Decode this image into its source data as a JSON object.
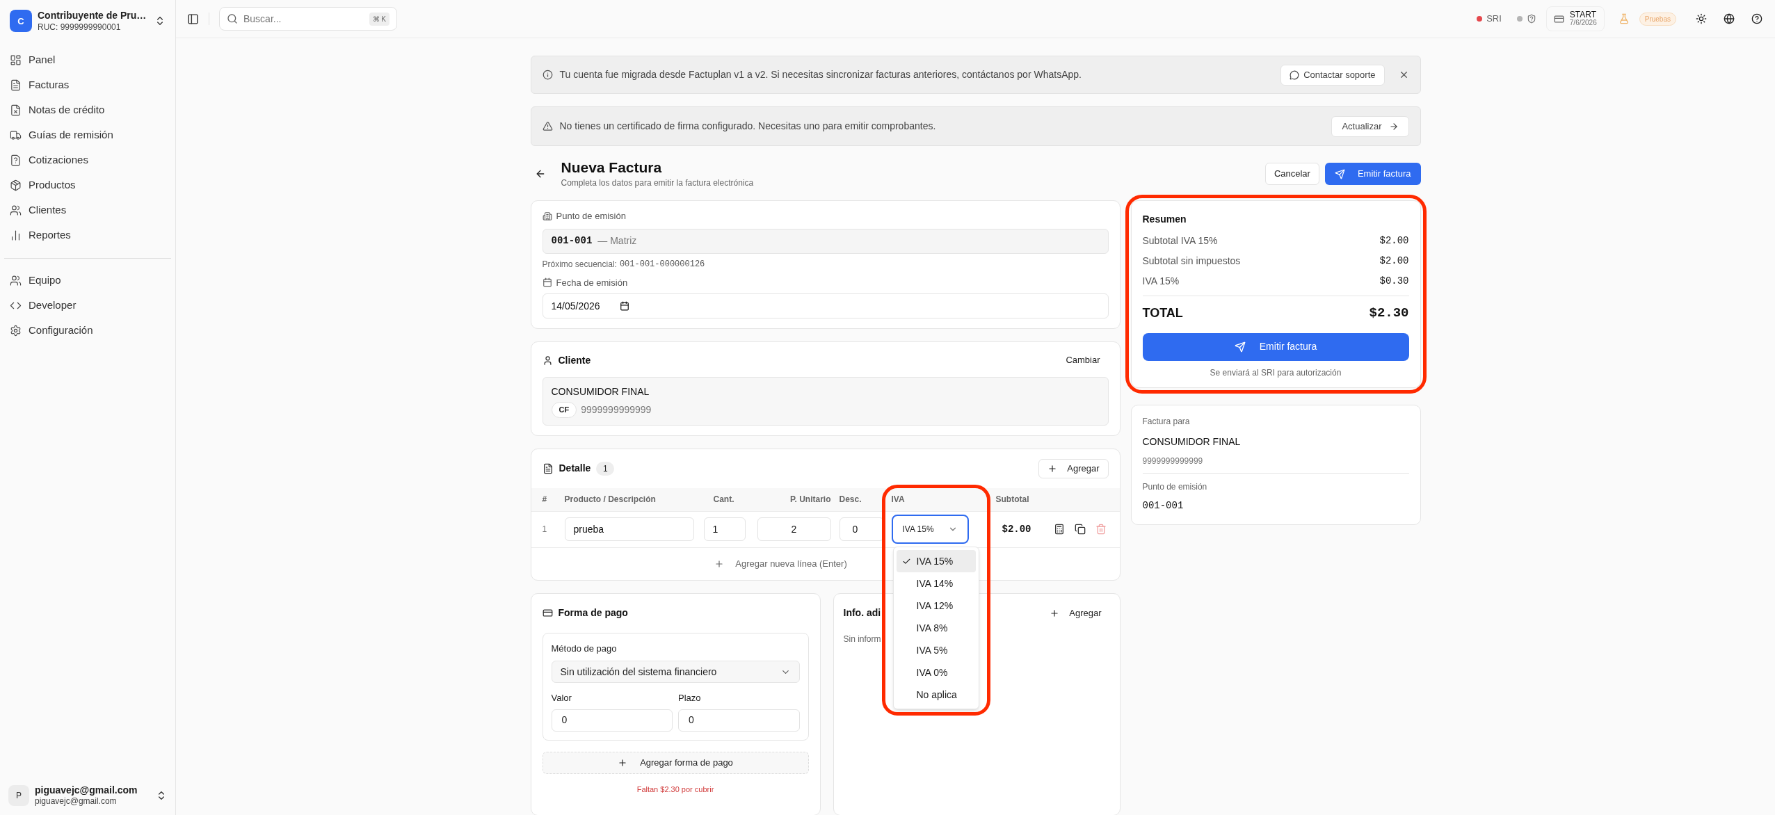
{
  "sidebar": {
    "org": {
      "avatar": "C",
      "name": "Contribuyente de Pru…",
      "ruc": "RUC: 9999999990001"
    },
    "nav": [
      {
        "label": "Panel"
      },
      {
        "label": "Facturas"
      },
      {
        "label": "Notas de crédito"
      },
      {
        "label": "Guías de remisión"
      },
      {
        "label": "Cotizaciones"
      },
      {
        "label": "Productos"
      },
      {
        "label": "Clientes"
      },
      {
        "label": "Reportes"
      }
    ],
    "nav_secondary": [
      {
        "label": "Equipo"
      },
      {
        "label": "Developer"
      },
      {
        "label": "Configuración"
      }
    ],
    "user": {
      "avatar": "P",
      "name": "piguavejc@gmail.com",
      "email": "piguavejc@gmail.com"
    }
  },
  "header": {
    "search": {
      "placeholder": "Buscar...",
      "shortcut": "⌘ K"
    },
    "sri": {
      "label": "SRI",
      "color": "#e5484d"
    },
    "cert_status": {
      "color": "#b5b5b5"
    },
    "plan": {
      "name": "START",
      "date": "7/6/2026"
    },
    "env_badge": "Pruebas"
  },
  "banners": [
    {
      "kind": "info",
      "text": "Tu cuenta fue migrada desde Factuplan v1 a v2. Si necesitas sincronizar facturas anteriores, contáctanos por WhatsApp.",
      "action": "Contactar soporte"
    },
    {
      "kind": "warning",
      "text": "No tienes un certificado de firma configurado. Necesitas uno para emitir comprobantes.",
      "action": "Actualizar"
    }
  ],
  "page": {
    "title": "Nueva Factura",
    "subtitle": "Completa los datos para emitir la factura electrónica",
    "cancel": "Cancelar",
    "submit": "Emitir factura"
  },
  "emission": {
    "point_label": "Punto de emisión",
    "point_code": "001-001",
    "point_name": "— Matriz",
    "next_label": "Próximo secuencial:",
    "next_value": "001-001-000000126",
    "date_label": "Fecha de emisión",
    "date_value": "14/05/2026"
  },
  "client": {
    "title": "Cliente",
    "change": "Cambiar",
    "name": "CONSUMIDOR FINAL",
    "badge": "CF",
    "id": "9999999999999"
  },
  "detail": {
    "title": "Detalle",
    "count": "1",
    "add": "Agregar",
    "columns": [
      "#",
      "Producto / Descripción",
      "Cant.",
      "P. Unitario",
      "Desc.",
      "IVA",
      "Subtotal"
    ],
    "rows": [
      {
        "index": "1",
        "product": "prueba",
        "qty": "1",
        "price": "2",
        "discount": "0",
        "iva": "IVA 15%",
        "subtotal": "$2.00"
      }
    ],
    "add_line": "Agregar nueva línea (Enter)",
    "iva_menu": {
      "highlighted": true,
      "options": [
        {
          "label": "IVA 15%",
          "selected": true
        },
        {
          "label": "IVA 14%",
          "selected": false
        },
        {
          "label": "IVA 12%",
          "selected": false
        },
        {
          "label": "IVA 8%",
          "selected": false
        },
        {
          "label": "IVA 5%",
          "selected": false
        },
        {
          "label": "IVA 0%",
          "selected": false
        },
        {
          "label": "No aplica",
          "selected": false
        }
      ]
    }
  },
  "payment": {
    "title": "Forma de pago",
    "method_label": "Método de pago",
    "method_value": "Sin utilización del sistema financiero",
    "value_label": "Valor",
    "value": "0",
    "term_label": "Plazo",
    "term": "0",
    "add": "Agregar forma de pago",
    "warning": "Faltan $2.30 por cubrir"
  },
  "extra_info": {
    "title": "Info. adi",
    "add": "Agregar",
    "empty": "Sin inform"
  },
  "summary": {
    "highlighted": true,
    "title": "Resumen",
    "rows": [
      {
        "label": "Subtotal IVA 15%",
        "value": "$2.00"
      },
      {
        "label": "Subtotal sin impuestos",
        "value": "$2.00"
      },
      {
        "label": "IVA 15%",
        "value": "$0.30"
      }
    ],
    "total_label": "TOTAL",
    "total_value": "$2.30",
    "submit": "Emitir factura",
    "note": "Se enviará al SRI para autorización"
  },
  "recipient": {
    "for_label": "Factura para",
    "name": "CONSUMIDOR FINAL",
    "id": "9999999999999",
    "point_label": "Punto de emisión",
    "point_value": "001-001"
  }
}
